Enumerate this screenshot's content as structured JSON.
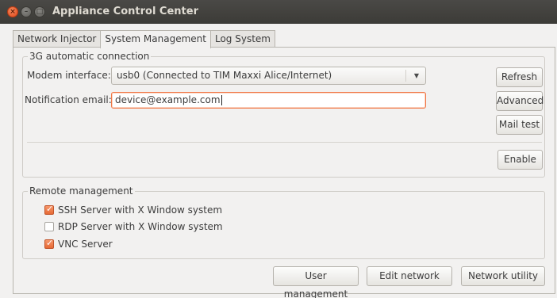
{
  "window": {
    "title": "Appliance Control Center"
  },
  "tabs": [
    {
      "label": "Network Injector"
    },
    {
      "label": "System Management"
    },
    {
      "label": "Log System"
    }
  ],
  "connection_frame": {
    "title": "3G automatic connection",
    "modem_label": "Modem interface:",
    "modem_value": "usb0 (Connected to TIM Maxxi Alice/Internet)",
    "email_label": "Notification email:",
    "email_value": "device@example.com",
    "buttons": {
      "refresh": "Refresh",
      "advanced": "Advanced",
      "mail_test": "Mail test",
      "enable": "Enable"
    }
  },
  "remote_frame": {
    "title": "Remote management",
    "options": [
      {
        "label": "SSH Server with X Window system",
        "checked": true
      },
      {
        "label": "RDP Server with X Window system",
        "checked": false
      },
      {
        "label": "VNC Server",
        "checked": true
      }
    ]
  },
  "bottom_buttons": {
    "user_management": "User management",
    "edit_network": "Edit network",
    "network_utility": "Network utility"
  },
  "colors": {
    "accent": "#e66a35",
    "titlebar": "#3c3b37",
    "background": "#f2f1f0"
  }
}
